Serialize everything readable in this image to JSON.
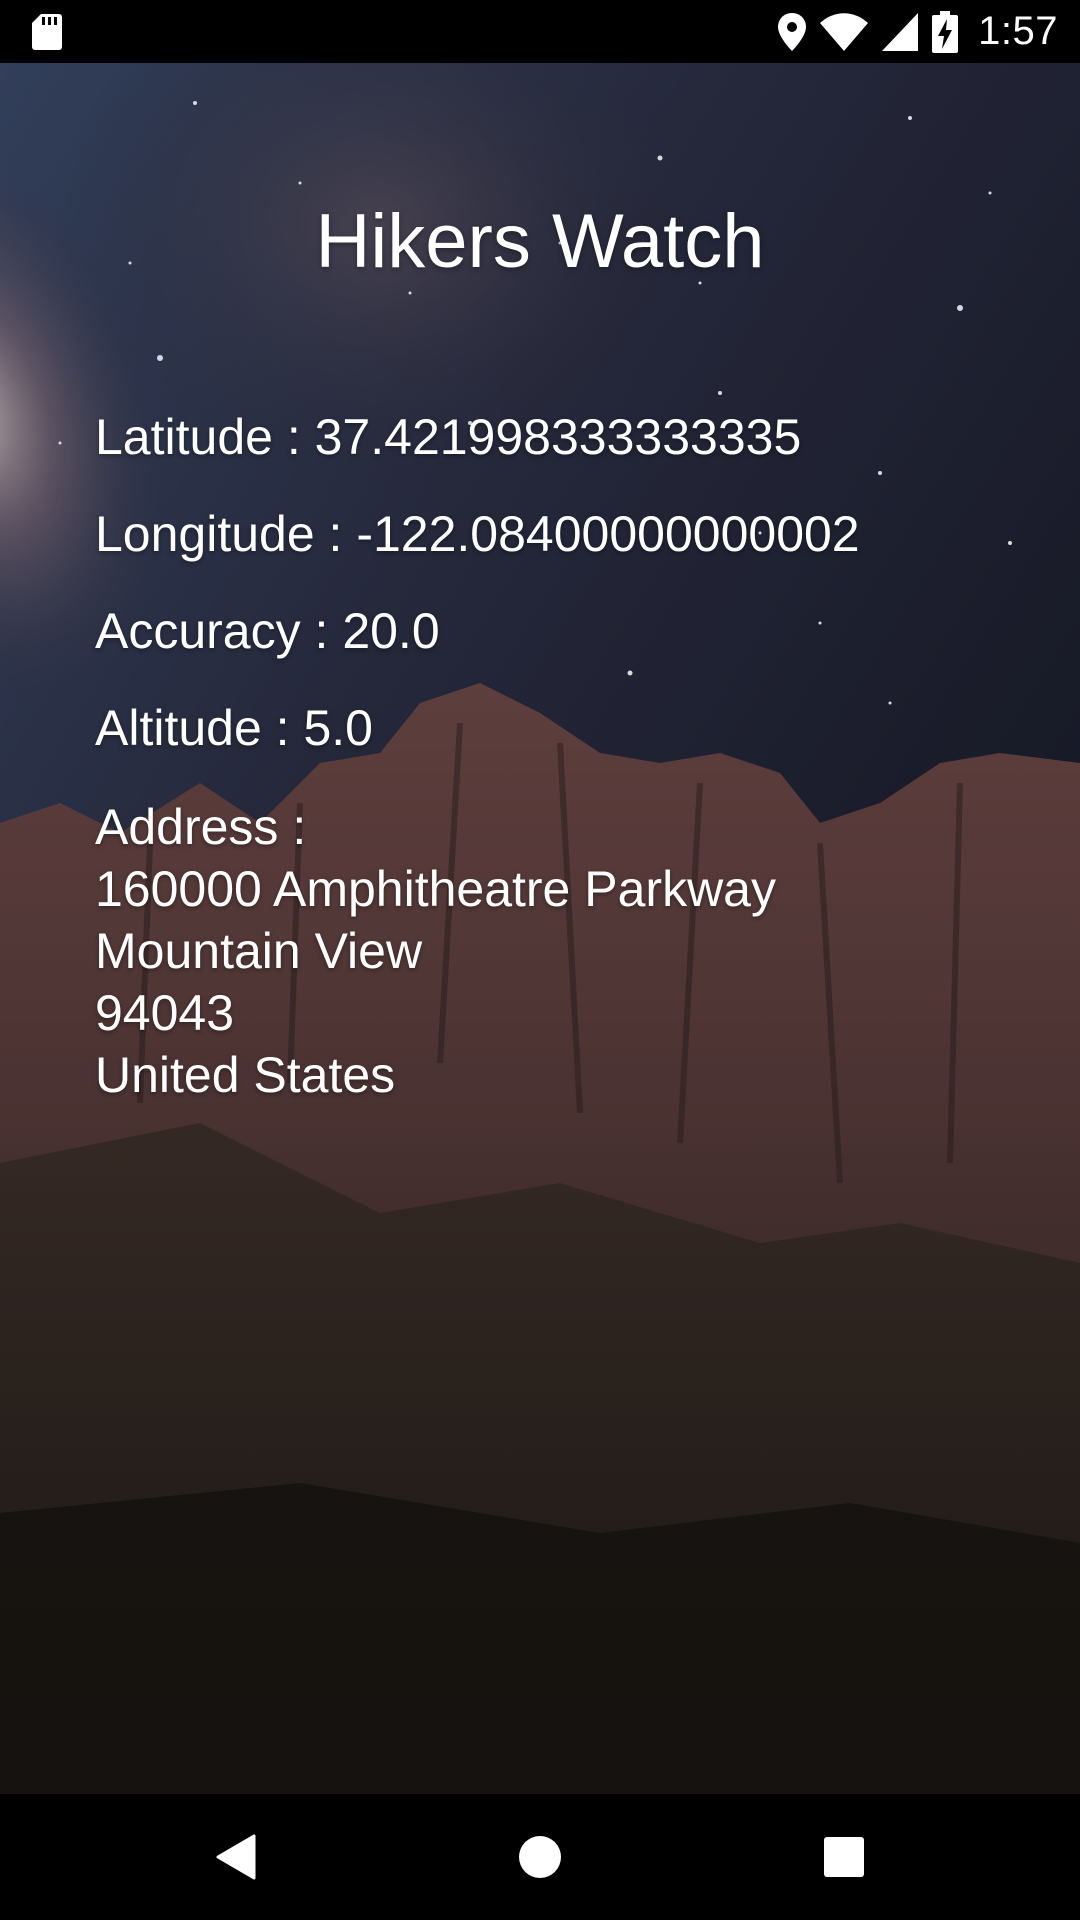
{
  "status_bar": {
    "time": "1:57",
    "icons": [
      "sd-card-icon",
      "location-icon",
      "wifi-icon",
      "cell-signal-icon",
      "battery-charging-icon"
    ]
  },
  "app": {
    "title": "Hikers Watch"
  },
  "location": {
    "latitude_label": "Latitude",
    "latitude_value": "37.421998333333335",
    "longitude_label": "Longitude",
    "longitude_value": "-122.08400000000002",
    "accuracy_label": "Accuracy",
    "accuracy_value": "20.0",
    "altitude_label": "Altitude",
    "altitude_value": "5.0",
    "separator": " : "
  },
  "address": {
    "label": "Address :",
    "lines": [
      "160000 Amphitheatre Parkway",
      "Mountain View",
      "94043",
      "United States"
    ]
  },
  "nav_bar": {
    "icons": [
      "back-icon",
      "home-icon",
      "recents-icon"
    ]
  },
  "colors": {
    "text": "#ffffff",
    "bars": "#000000"
  }
}
